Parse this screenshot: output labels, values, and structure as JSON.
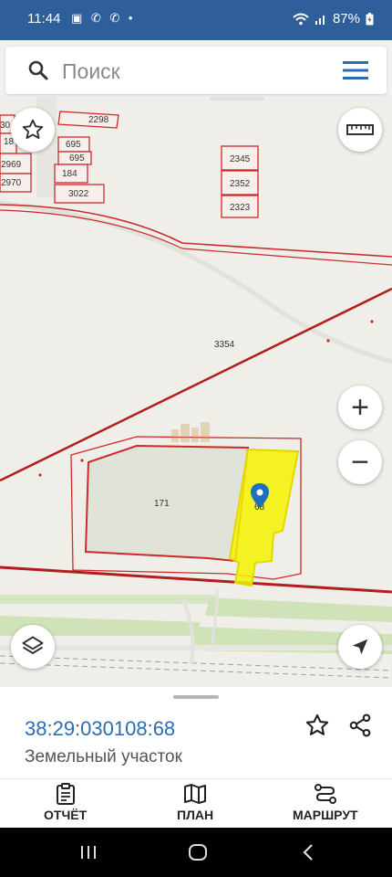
{
  "status_bar": {
    "time": "11:44",
    "notif_icons": "▣ ✆ ✆ •",
    "battery": "87%",
    "wifi_icon": "wifi-icon",
    "signal_icon": "signal-icon",
    "battery_icon": "battery-charging-icon"
  },
  "search": {
    "placeholder": "Поиск",
    "icon": "search-icon",
    "menu_icon": "hamburger-menu-icon"
  },
  "map": {
    "parcel_labels": [
      "2298",
      "695",
      "695",
      "184",
      "2969",
      "2970",
      "3022",
      "2345",
      "2352",
      "2323",
      "3354",
      "171",
      "68",
      "18",
      "30"
    ],
    "selected_parcel_label": "68",
    "colors": {
      "map_bg": "#efeee8",
      "boundary": "#d22b2b",
      "selected_fill": "#f5f200",
      "field": "#dfe3d8",
      "green_strip": "#cfe2b8"
    },
    "controls": {
      "favorite": "star-outline-icon",
      "ruler": "ruler-icon",
      "zoom_in": "+",
      "zoom_out": "−",
      "layers": "layers-icon",
      "locate": "navigation-arrow-icon"
    }
  },
  "info_panel": {
    "cadastral_number": "38:29:030108:68",
    "type": "Земельный участок",
    "favorite_icon": "star-outline-icon",
    "share_icon": "share-icon"
  },
  "bottom_nav": {
    "items": [
      {
        "label": "ОТЧЁТ",
        "icon": "clipboard-icon"
      },
      {
        "label": "ПЛАН",
        "icon": "map-icon"
      },
      {
        "label": "МАРШРУТ",
        "icon": "route-icon"
      }
    ]
  },
  "system_nav": {
    "recents": "recents-icon",
    "home": "home-icon",
    "back": "back-icon"
  }
}
